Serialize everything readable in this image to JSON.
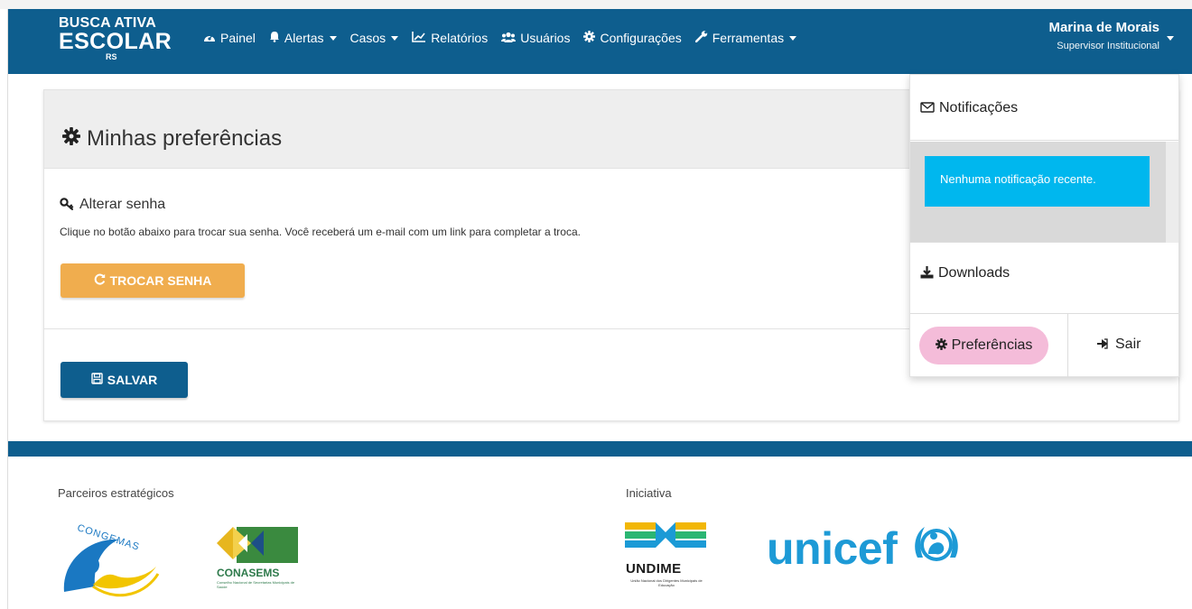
{
  "brand": {
    "line1": "BUSCA ATIVA",
    "line2": "ESCOLAR",
    "line3": "RS"
  },
  "nav": {
    "items": [
      {
        "label": "Painel",
        "icon": "dashboard-icon",
        "has_caret": false
      },
      {
        "label": "Alertas",
        "icon": "bell-icon",
        "has_caret": true
      },
      {
        "label": "Casos",
        "icon": "",
        "has_caret": true
      },
      {
        "label": "Relatórios",
        "icon": "line-chart-icon",
        "has_caret": false
      },
      {
        "label": "Usuários",
        "icon": "users-icon",
        "has_caret": false
      },
      {
        "label": "Configurações",
        "icon": "gear-icon",
        "has_caret": false
      },
      {
        "label": "Ferramentas",
        "icon": "wrench-icon",
        "has_caret": true
      }
    ]
  },
  "user": {
    "name": "Marina de Morais",
    "role": "Supervisor Institucional"
  },
  "panel": {
    "title": "Minhas preferências",
    "section_title": "Alterar senha",
    "section_desc": "Clique no botão abaixo para trocar sua senha. Você receberá um e-mail com um link para completar a troca.",
    "change_password_label": "TROCAR SENHA",
    "save_label": "SALVAR"
  },
  "dropdown": {
    "notifications_title": "Notificações",
    "no_notifications": "Nenhuma notificação recente.",
    "downloads_label": "Downloads",
    "preferences_label": "Preferências",
    "logout_label": "Sair"
  },
  "footer": {
    "partners_label": "Parceiros estratégicos",
    "initiative_label": "Iniciativa",
    "congemas_text": "CONGEMAS",
    "conasems_text": "CONASEMS",
    "conasems_sub": "Conselho Nacional de Secretarias Municipais de Saúde",
    "undime_text": "UNDIME",
    "undime_sub": "União Nacional dos Dirigentes Municipais de Educação",
    "unicef_text": "unicef"
  },
  "colors": {
    "navbar": "#0e5e8e",
    "warning_button": "#f0ad4e",
    "primary_button": "#0e5e8e",
    "info_alert": "#00b7ee",
    "preferences_highlight": "#f4bcd9",
    "unicef_blue": "#1d9ad6"
  }
}
